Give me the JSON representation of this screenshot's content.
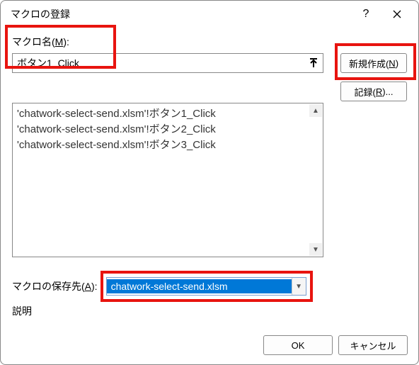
{
  "titlebar": {
    "title": "マクロの登録"
  },
  "labels": {
    "macroName": "マクロ名(M):",
    "saveLocation": "マクロの保存先(A):",
    "description": "説明"
  },
  "macroName": {
    "value": "ボタン1_Click"
  },
  "macros": [
    "'chatwork-select-send.xlsm'!ボタン1_Click",
    "'chatwork-select-send.xlsm'!ボタン2_Click",
    "'chatwork-select-send.xlsm'!ボタン3_Click"
  ],
  "buttons": {
    "create": "新規作成(N)",
    "record": "記録(R)...",
    "ok": "OK",
    "cancel": "キャンセル"
  },
  "saveLocation": {
    "selected": "chatwork-select-send.xlsm"
  }
}
